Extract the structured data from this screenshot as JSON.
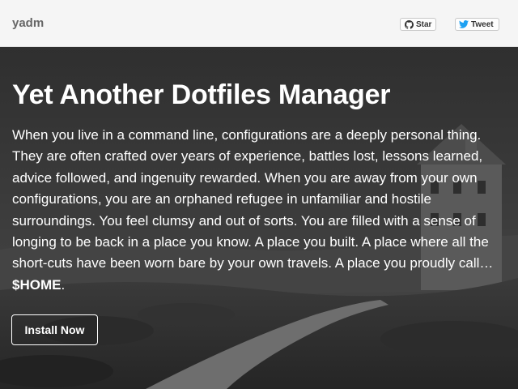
{
  "header": {
    "brand": "yadm",
    "star_label": "Star",
    "tweet_label": "Tweet"
  },
  "hero": {
    "title": "Yet Another Dotfiles Manager",
    "description": "When you live in a command line, configurations are a deeply personal thing. They are often crafted over years of experience, battles lost, lessons learned, advice followed, and ingenuity rewarded. When you are away from your own configurations, you are an orphaned refugee in unfamiliar and hostile surroundings. You feel clumsy and out of sorts. You are filled with a sense of longing to be back in a place you know. A place you built. A place where all the short-cuts have been worn bare by your own travels. A place you proudly call…",
    "home_token": "$HOME",
    "home_suffix": ".",
    "install_label": "Install Now"
  },
  "icons": {
    "star": "github-icon",
    "tweet": "twitter-bird-icon"
  },
  "colors": {
    "topbar_bg": "#f5f5f5",
    "brand_text": "#666666",
    "hero_text": "#ffffff",
    "twitter_blue": "#1da1f2"
  }
}
